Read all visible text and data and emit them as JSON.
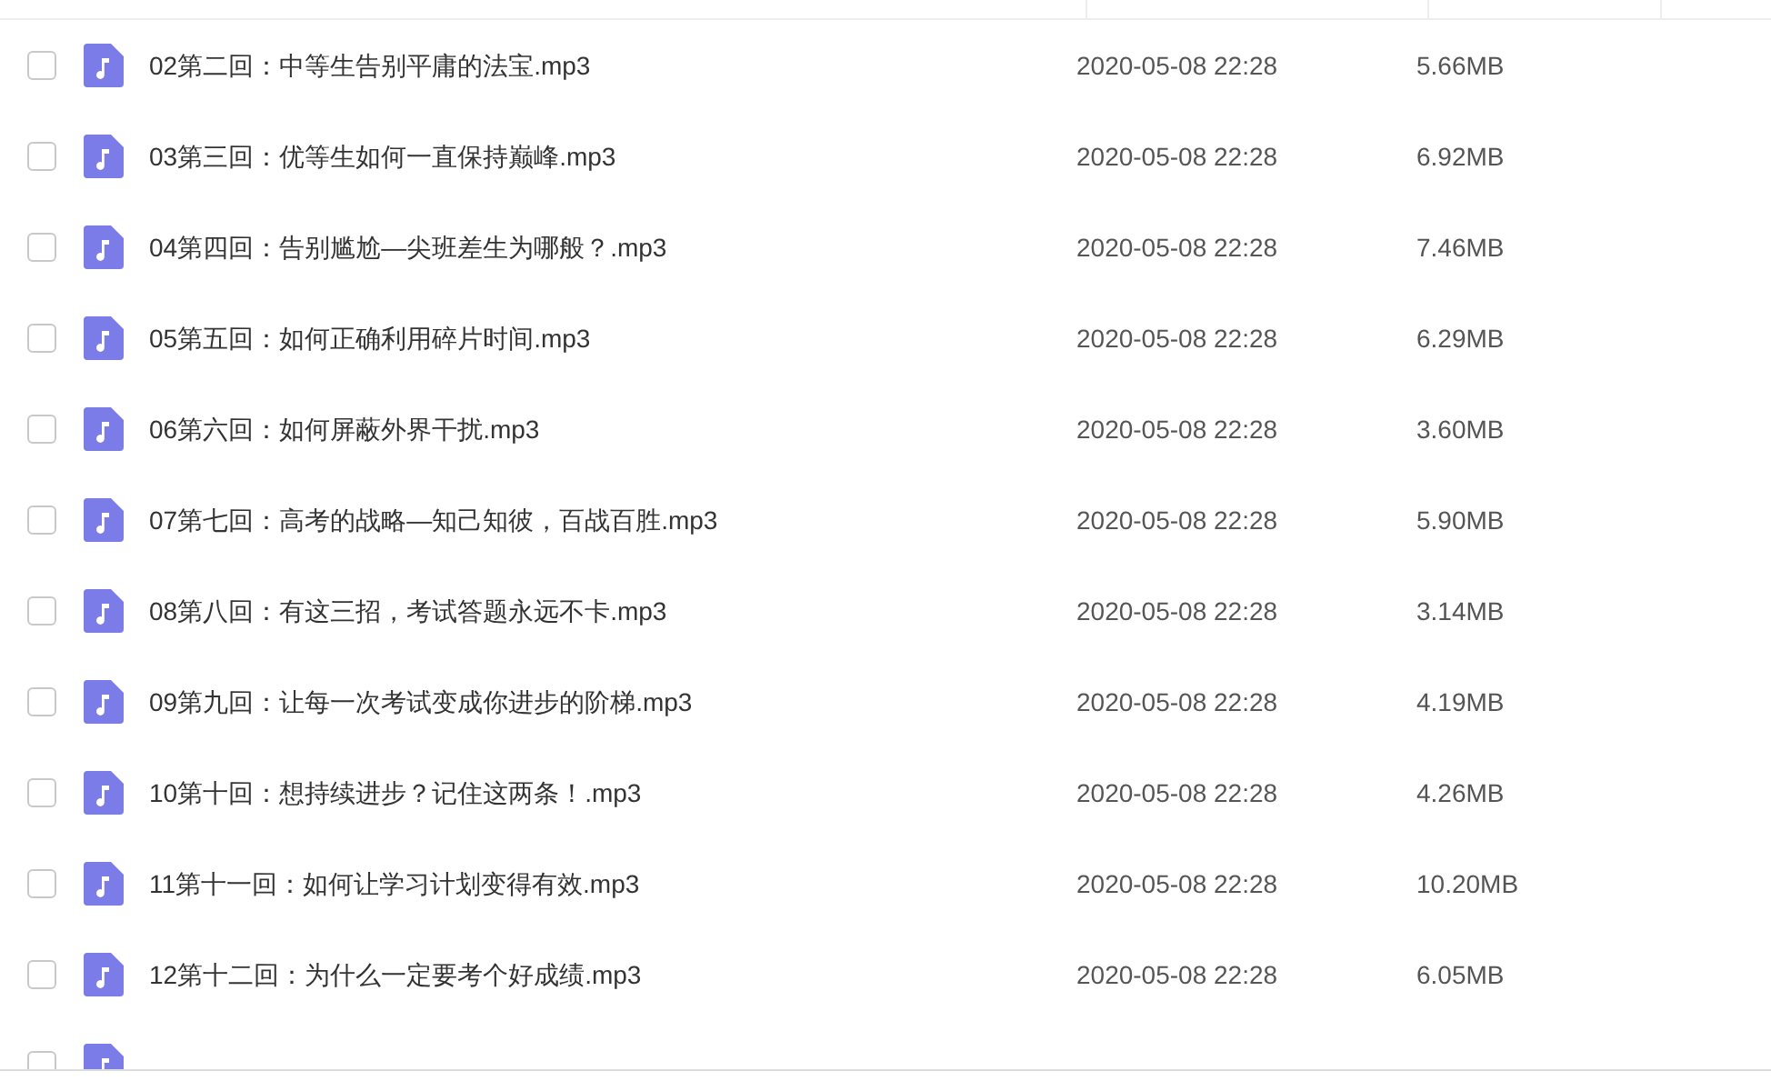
{
  "files": [
    {
      "name": "02第二回：中等生告别平庸的法宝.mp3",
      "modified": "2020-05-08 22:28",
      "size": "5.66MB",
      "checked": false
    },
    {
      "name": "03第三回：优等生如何一直保持巅峰.mp3",
      "modified": "2020-05-08 22:28",
      "size": "6.92MB",
      "checked": false
    },
    {
      "name": "04第四回：告别尴尬—尖班差生为哪般？.mp3",
      "modified": "2020-05-08 22:28",
      "size": "7.46MB",
      "checked": false
    },
    {
      "name": "05第五回：如何正确利用碎片时间.mp3",
      "modified": "2020-05-08 22:28",
      "size": "6.29MB",
      "checked": false
    },
    {
      "name": "06第六回：如何屏蔽外界干扰.mp3",
      "modified": "2020-05-08 22:28",
      "size": "3.60MB",
      "checked": false
    },
    {
      "name": "07第七回：高考的战略—知己知彼，百战百胜.mp3",
      "modified": "2020-05-08 22:28",
      "size": "5.90MB",
      "checked": false
    },
    {
      "name": "08第八回：有这三招，考试答题永远不卡.mp3",
      "modified": "2020-05-08 22:28",
      "size": "3.14MB",
      "checked": false
    },
    {
      "name": "09第九回：让每一次考试变成你进步的阶梯.mp3",
      "modified": "2020-05-08 22:28",
      "size": "4.19MB",
      "checked": false
    },
    {
      "name": "10第十回：想持续进步？记住这两条！.mp3",
      "modified": "2020-05-08 22:28",
      "size": "4.26MB",
      "checked": false
    },
    {
      "name": "11第十一回：如何让学习计划变得有效.mp3",
      "modified": "2020-05-08 22:28",
      "size": "10.20MB",
      "checked": false
    },
    {
      "name": "12第十二回：为什么一定要考个好成绩.mp3",
      "modified": "2020-05-08 22:28",
      "size": "6.05MB",
      "checked": false
    },
    {
      "checked": false
    }
  ]
}
